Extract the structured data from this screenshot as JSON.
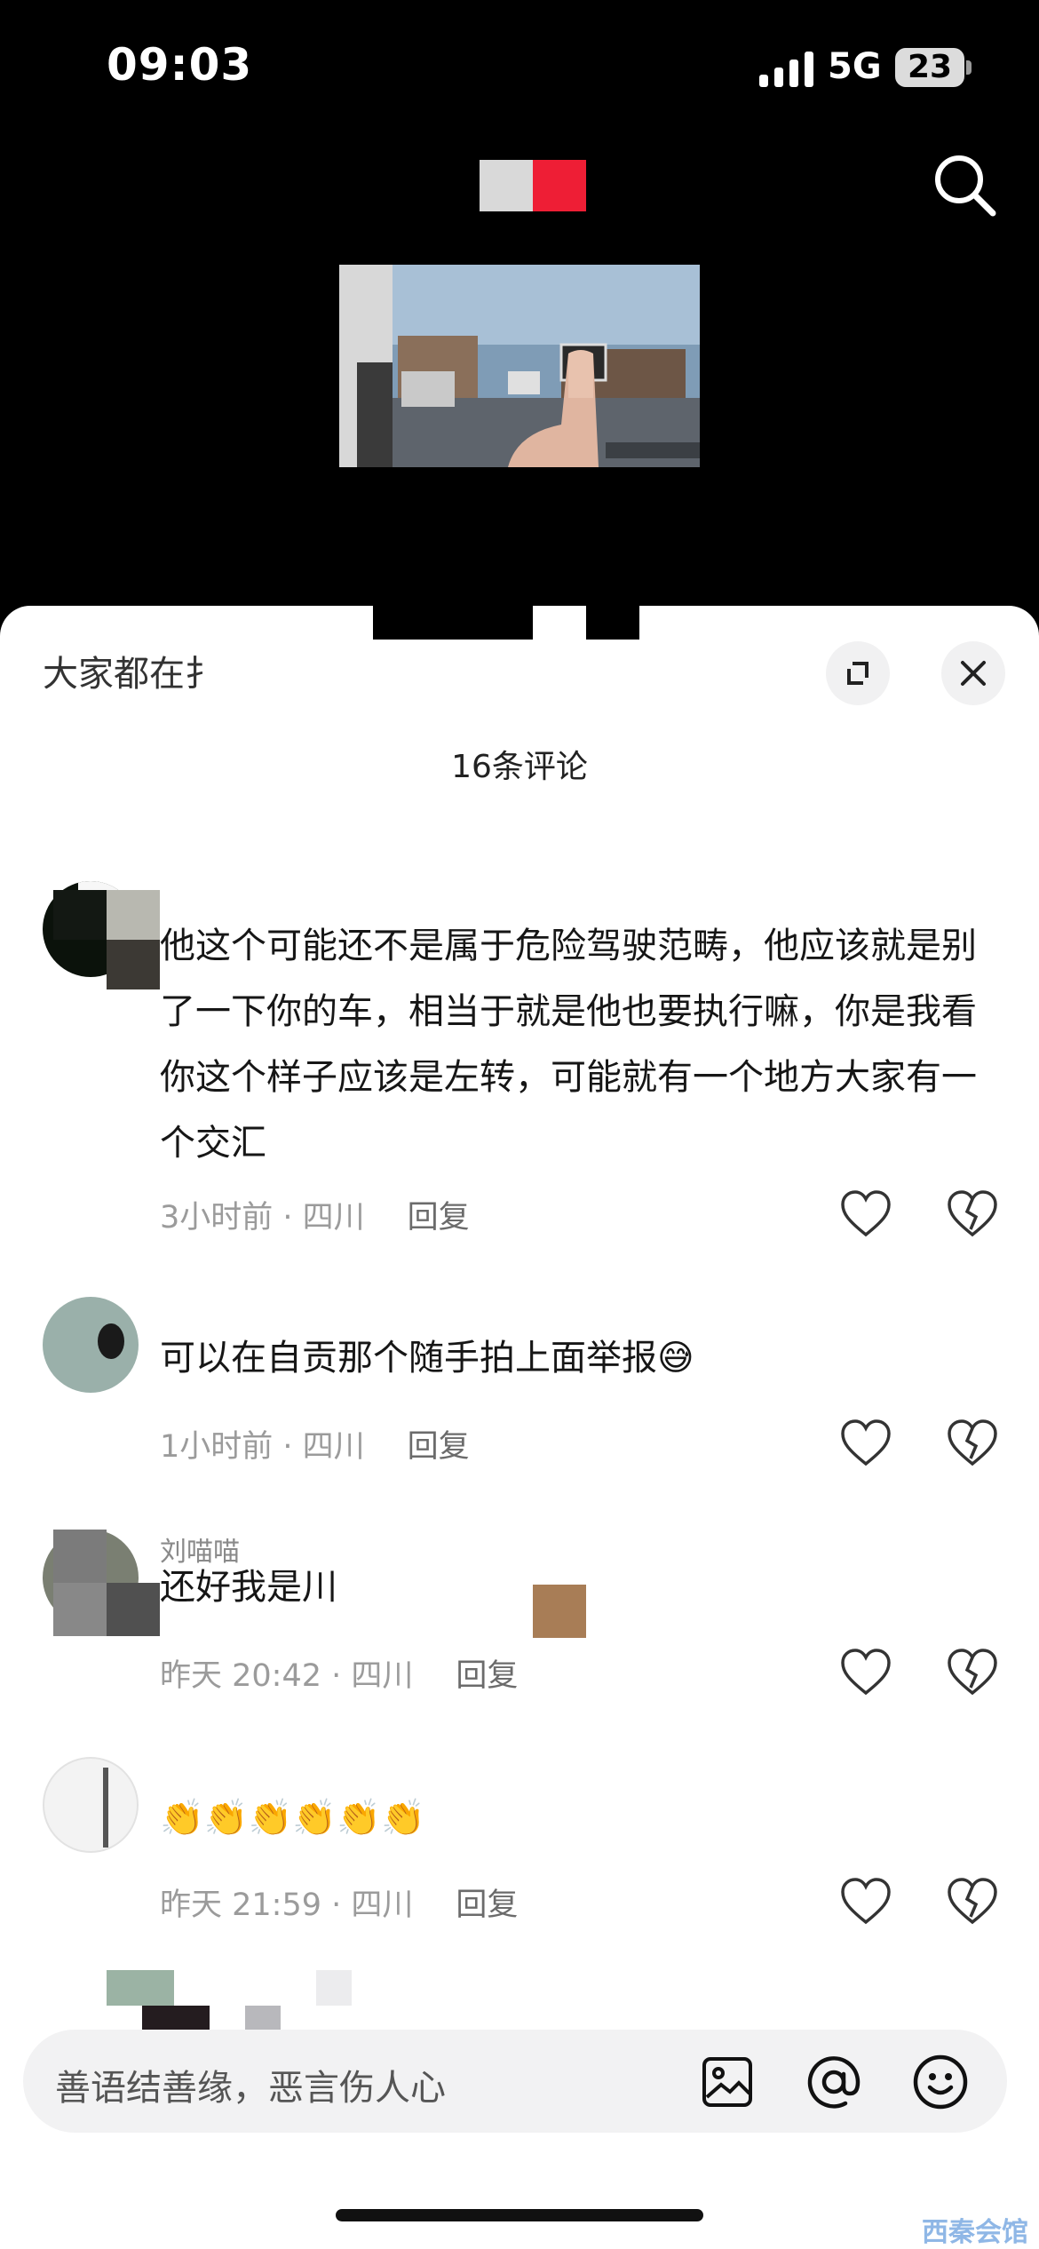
{
  "status_bar": {
    "time": "09:03",
    "network": "5G",
    "battery": "23"
  },
  "sheet": {
    "header_title": "大家都在扌",
    "comment_count": "16条评论"
  },
  "comments": [
    {
      "username": "",
      "text": "他这个可能还不是属于危险驾驶范畴，他应该就是别了一下你的车，相当于就是他也要执行嘛，你是我看你这个样子应该是左转，可能就有一个地方大家有一个交汇",
      "time_location": "3小时前 · 四川",
      "reply": "回复"
    },
    {
      "username": "",
      "text": "可以在自贡那个随手拍上面举报😅",
      "time_location": "1小时前 · 四川",
      "reply": "回复"
    },
    {
      "username": "刘喵喵",
      "text": "还好我是川",
      "time_location": "昨天 20:42 · 四川",
      "reply": "回复"
    },
    {
      "username": "",
      "text": "👏👏👏👏👏👏",
      "time_location": "昨天 21:59 · 四川",
      "reply": "回复"
    }
  ],
  "input": {
    "placeholder": "善语结善缘，恶言伤人心"
  },
  "watermark": "西秦会馆",
  "icons": {
    "search": "search-icon",
    "expand": "expand-icon",
    "close": "close-icon",
    "like": "heart-icon",
    "dislike": "broken-heart-icon",
    "image": "image-icon",
    "at": "at-icon",
    "emoji": "smiley-icon"
  },
  "colors": {
    "accent_red": "#ee1e35",
    "sheet_bg": "#ffffff",
    "muted_text": "#9b9b9b"
  }
}
